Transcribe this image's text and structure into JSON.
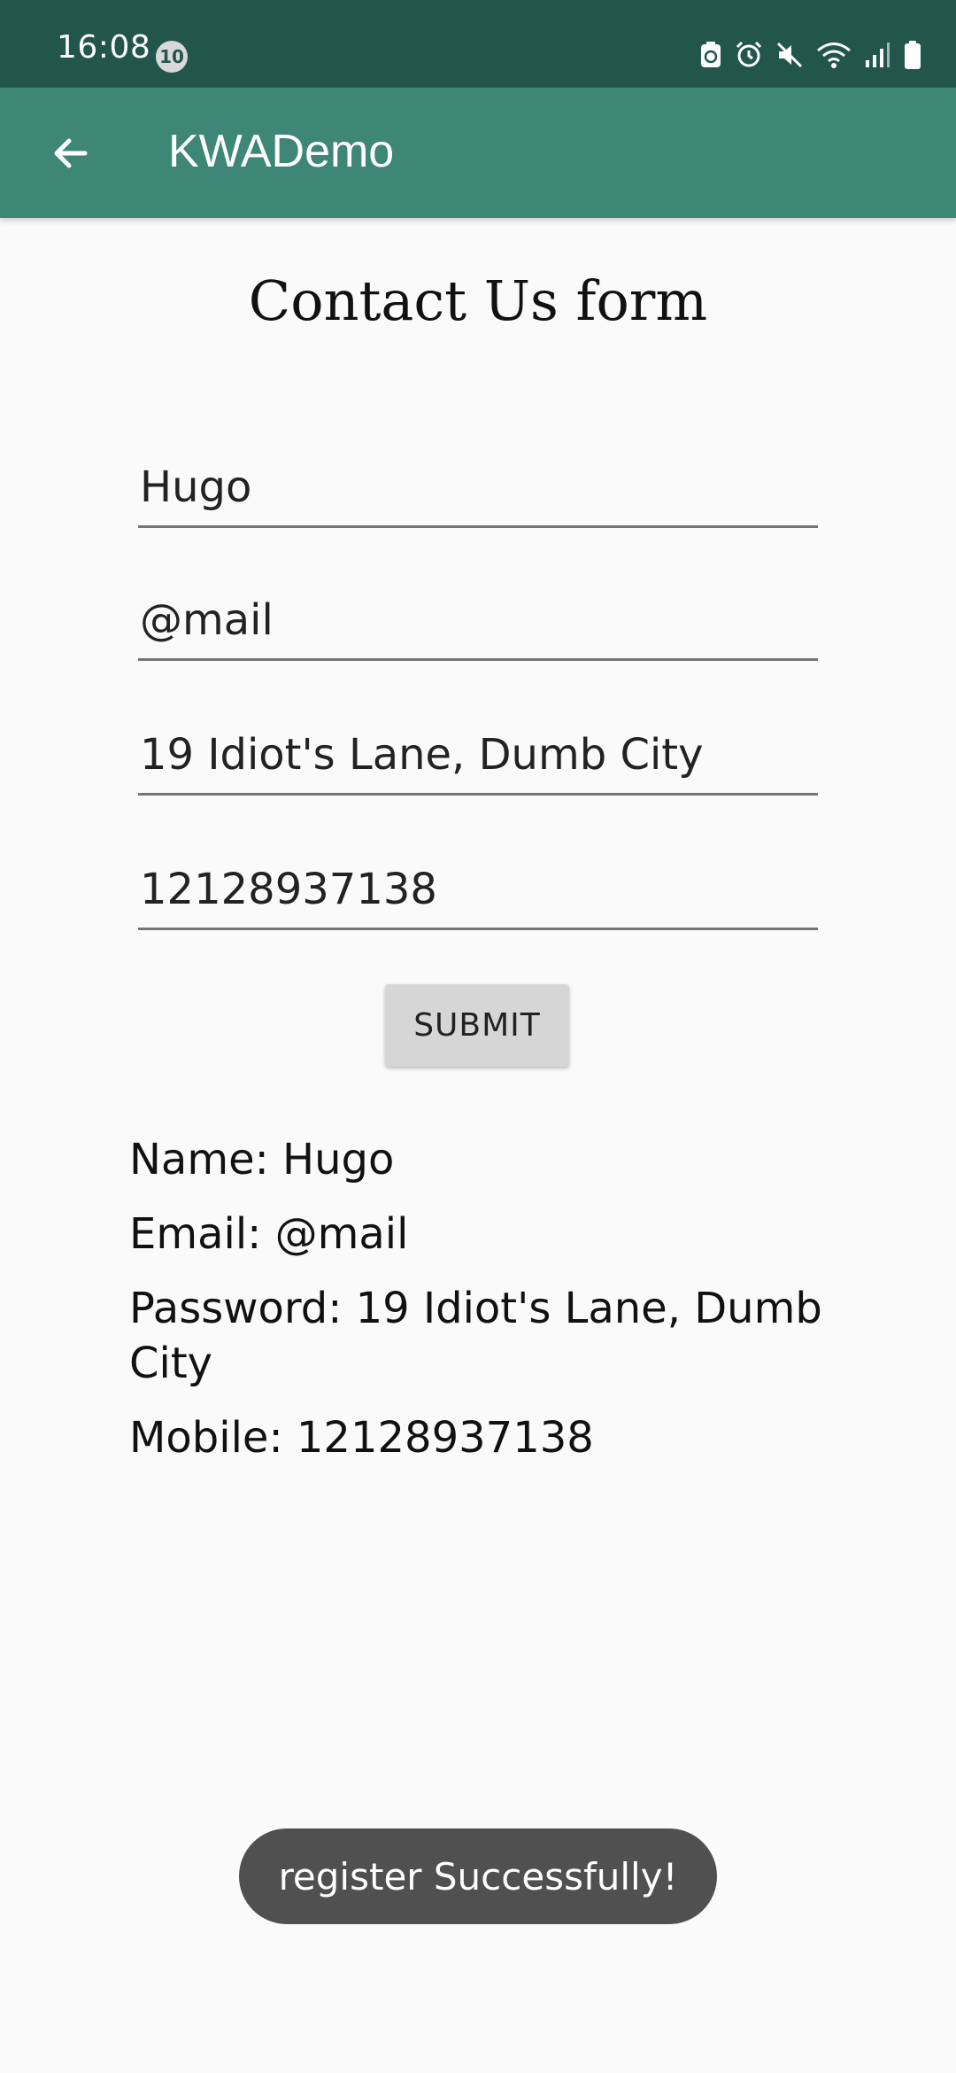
{
  "status_bar": {
    "time": "16:08",
    "notification_count": "10",
    "icons": [
      "recycle-icon",
      "alarm-icon",
      "mute-icon",
      "wifi-icon",
      "signal-icon",
      "battery-icon"
    ]
  },
  "app_bar": {
    "back_icon": "arrow-left-icon",
    "title": "KWADemo"
  },
  "form": {
    "title": "Contact Us form",
    "name_value": "Hugo",
    "email_value": "@mail",
    "address_value": "19 Idiot's Lane, Dumb City",
    "mobile_value": "12128937138",
    "submit_label": "SUBMIT"
  },
  "results": {
    "name": "Name: Hugo",
    "email": "Email: @mail",
    "password": "Password: 19 Idiot's Lane, Dumb City",
    "mobile": "Mobile: 12128937138"
  },
  "toast": {
    "message": "register Successfully!"
  },
  "colors": {
    "status_bar": "#23564a",
    "app_bar": "#3e8777",
    "background": "#fafafa",
    "toast": "#505050"
  }
}
